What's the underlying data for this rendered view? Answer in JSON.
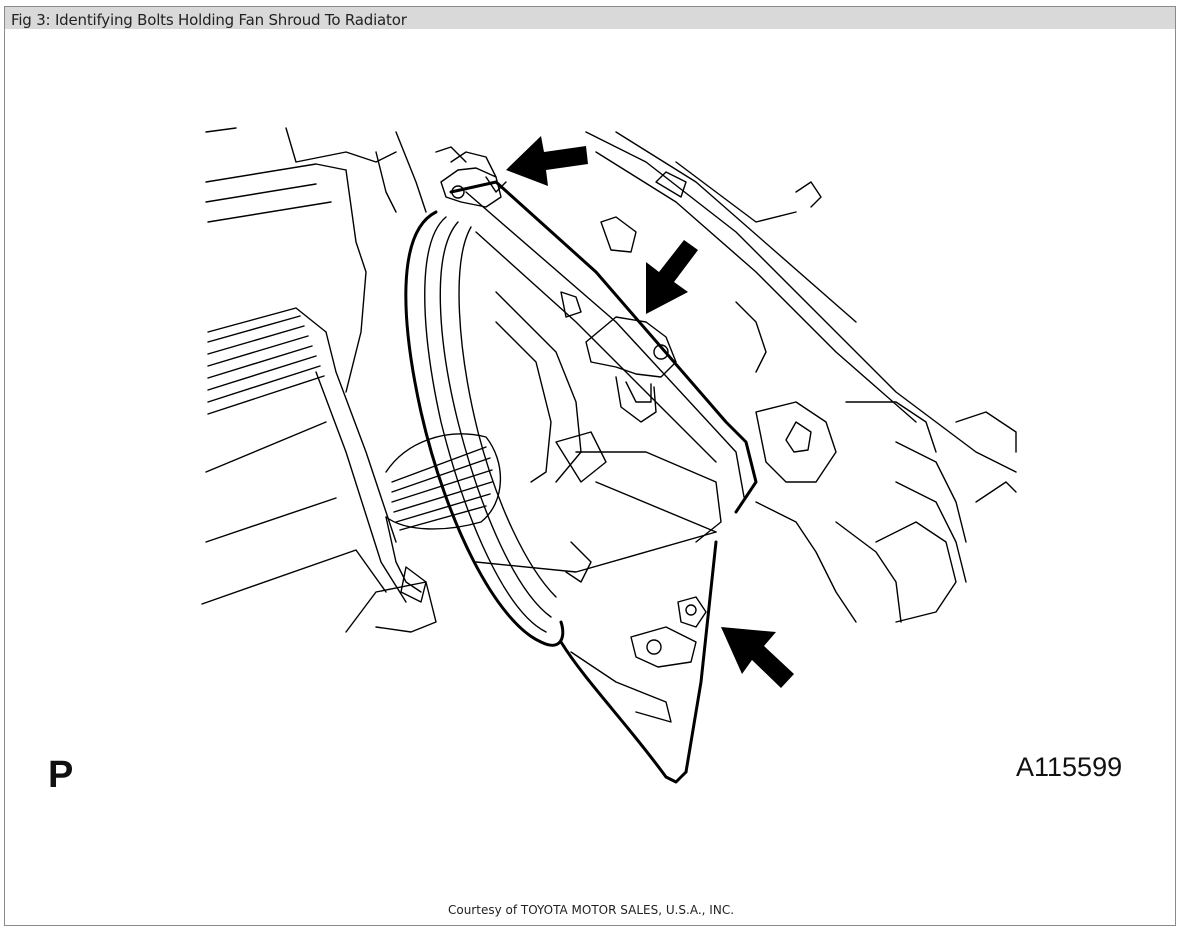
{
  "figure": {
    "title": "Fig 3: Identifying Bolts Holding Fan Shroud To Radiator",
    "corner_left_label": "P",
    "illustration_code": "A115599",
    "credit": "Courtesy of TOYOTA MOTOR SALES, U.S.A., INC."
  },
  "illustration": {
    "subject": "Fan shroud and radiator line drawing",
    "arrows": [
      "upper-bolt-arrow",
      "middle-bolt-arrow",
      "lower-bolt-arrow"
    ]
  }
}
